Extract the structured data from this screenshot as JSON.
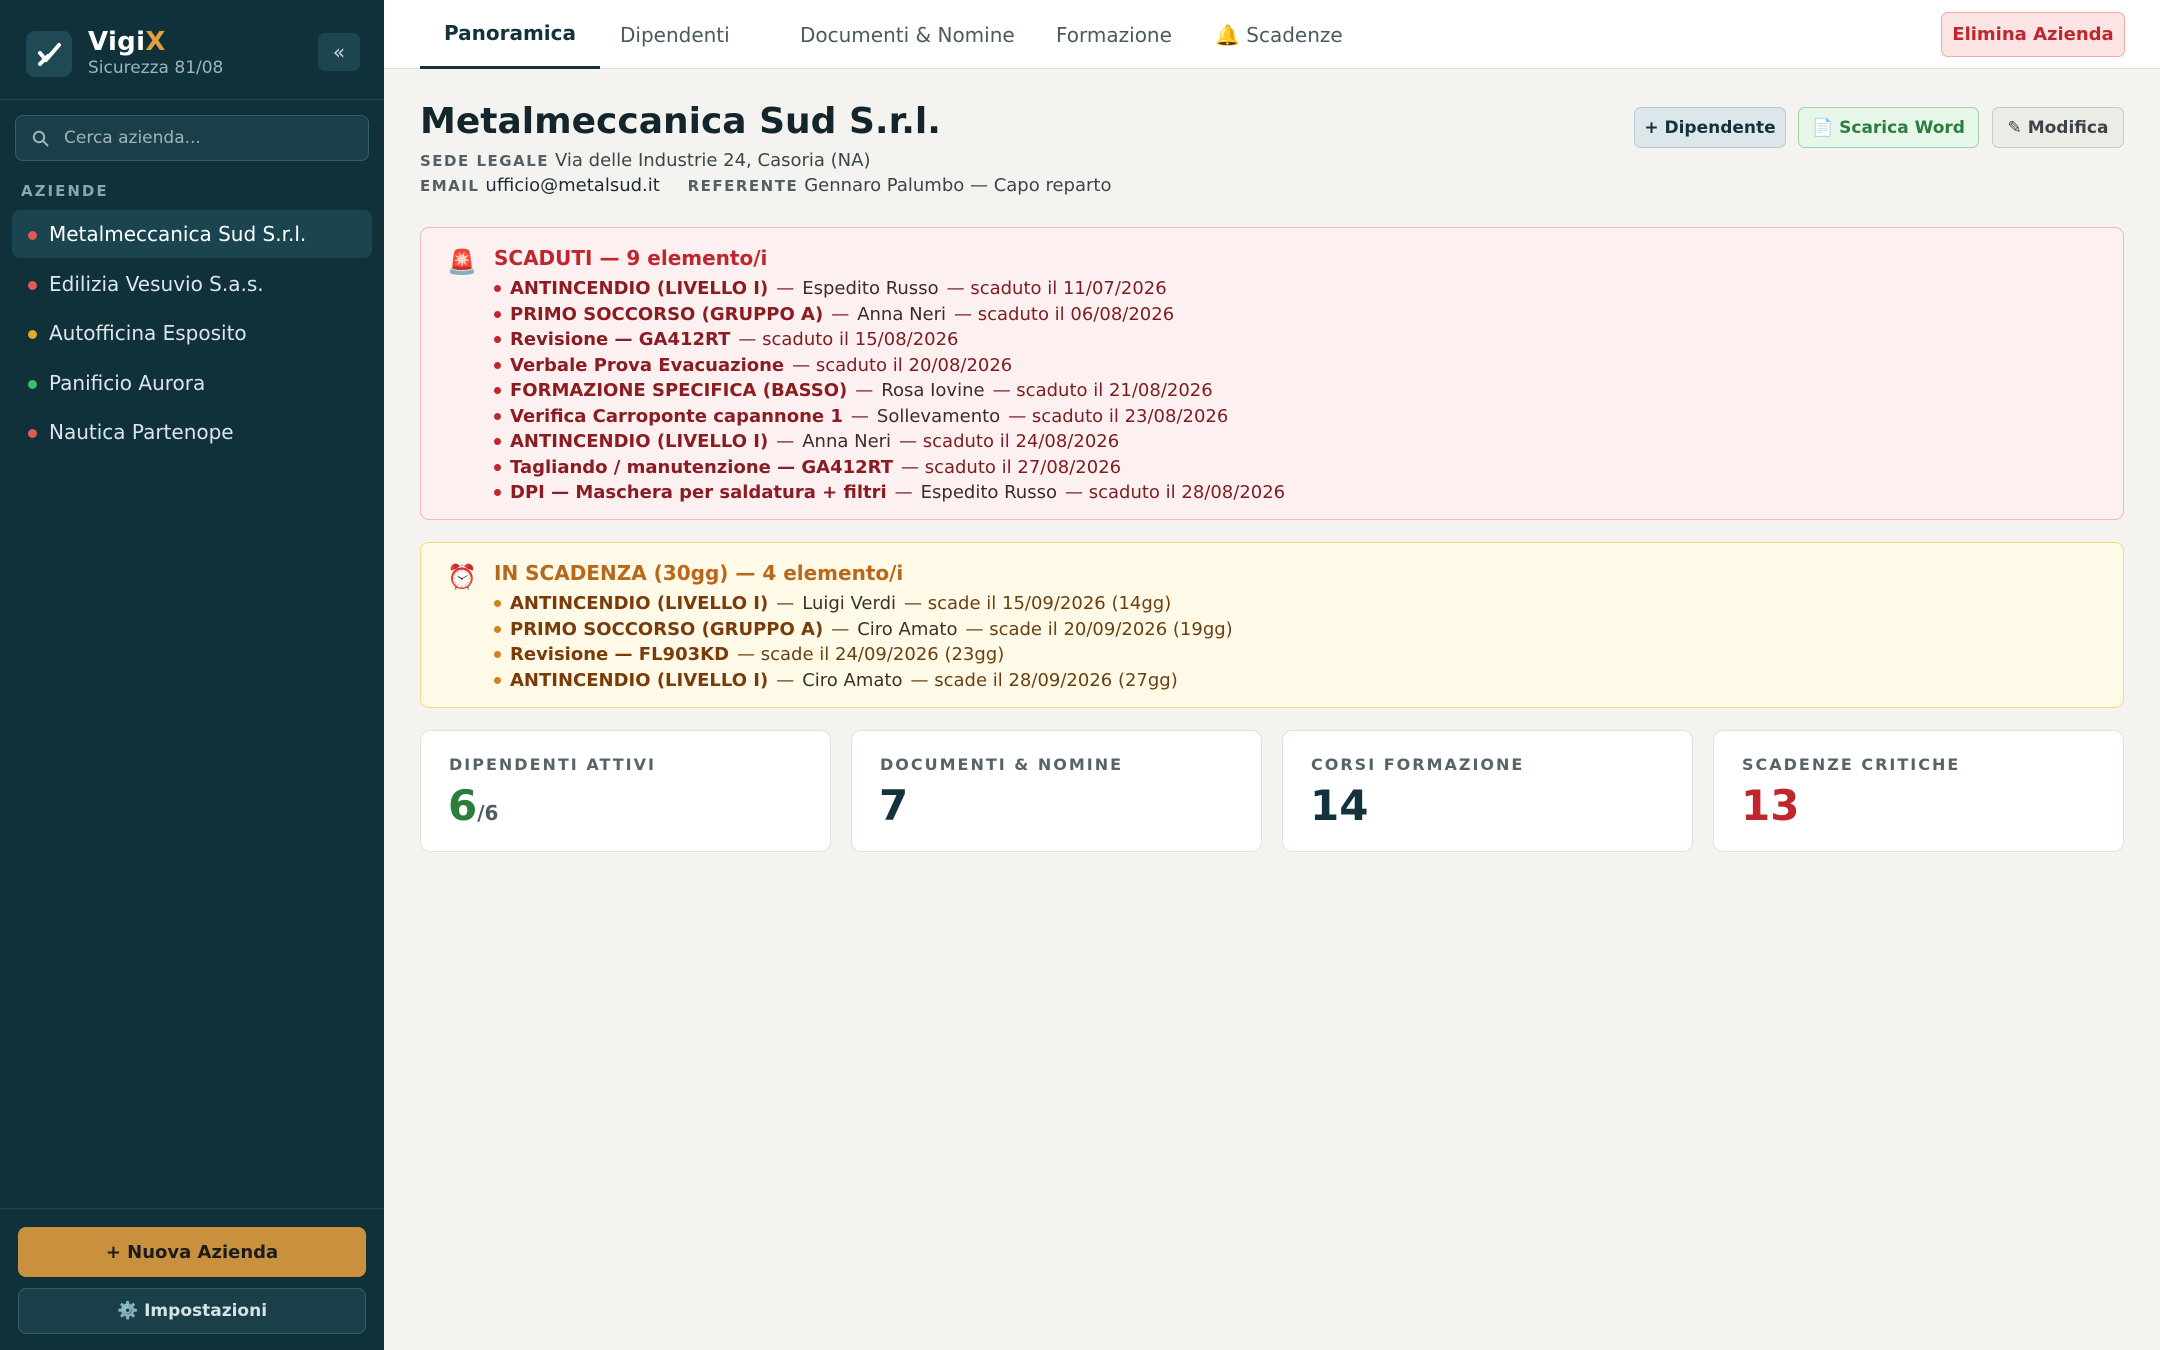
{
  "app": {
    "name_main": "Vigi",
    "name_accent": "X",
    "subtitle": "Sicurezza 81/08",
    "collapse_label": "«"
  },
  "sidebar": {
    "search_placeholder": "Cerca azienda...",
    "section_label": "AZIENDE",
    "companies": [
      {
        "name": "Metalmeccanica Sud S.r.l.",
        "status_color": "#e05a5a",
        "active": true
      },
      {
        "name": "Edilizia Vesuvio S.a.s.",
        "status_color": "#e05a5a",
        "active": false
      },
      {
        "name": "Autofficina Esposito",
        "status_color": "#e2a92a",
        "active": false
      },
      {
        "name": "Panificio Aurora",
        "status_color": "#3fbf6a",
        "active": false
      },
      {
        "name": "Nautica Partenope",
        "status_color": "#e05a5a",
        "active": false
      }
    ],
    "new_company_label": "+ Nuova Azienda",
    "settings_label": "Impostazioni",
    "settings_icon": "⚙️"
  },
  "tabs": [
    {
      "label": "Panoramica",
      "active": true
    },
    {
      "label": "Dipendenti",
      "active": false
    },
    {
      "label": "Documenti & Nomine",
      "active": false
    },
    {
      "label": "Formazione",
      "active": false
    },
    {
      "label": "🔔 Scadenze",
      "active": false
    }
  ],
  "delete_label": "Elimina Azienda",
  "company": {
    "name": "Metalmeccanica Sud S.r.l.",
    "sede_label": "SEDE LEGALE",
    "sede_value": "Via delle Industrie 24, Casoria (NA)",
    "email_label": "EMAIL",
    "email_value": "ufficio@metalsud.it",
    "referente_label": "REFERENTE",
    "referente_value": "Gennaro Palumbo — Capo reparto"
  },
  "actions": {
    "add_employee": "+ Dipendente",
    "download_word": "📄 Scarica Word",
    "edit": "✎ Modifica"
  },
  "expired": {
    "icon": "🚨",
    "title": "SCADUTI — 9 elemento/i",
    "items": [
      {
        "name": "ANTINCENDIO (LIVELLO I)",
        "person": "Espedito Russo",
        "date": "— scaduto il 11/07/2026"
      },
      {
        "name": "PRIMO SOCCORSO (GRUPPO A)",
        "person": "Anna Neri",
        "date": "— scaduto il 06/08/2026"
      },
      {
        "name": "Revisione — GA412RT",
        "person": "",
        "date": "— scaduto il 15/08/2026"
      },
      {
        "name": "Verbale Prova Evacuazione",
        "person": "",
        "date": "— scaduto il 20/08/2026"
      },
      {
        "name": "FORMAZIONE SPECIFICA (BASSO)",
        "person": "Rosa Iovine",
        "date": "— scaduto il 21/08/2026"
      },
      {
        "name": "Verifica Carroponte capannone 1",
        "person": "Sollevamento",
        "date": "— scaduto il 23/08/2026"
      },
      {
        "name": "ANTINCENDIO (LIVELLO I)",
        "person": "Anna Neri",
        "date": "— scaduto il 24/08/2026"
      },
      {
        "name": "Tagliando / manutenzione — GA412RT",
        "person": "",
        "date": "— scaduto il 27/08/2026"
      },
      {
        "name": "DPI — Maschera per saldatura + filtri",
        "person": "Espedito Russo",
        "date": "— scaduto il 28/08/2026"
      }
    ]
  },
  "expiring": {
    "icon": "⏰",
    "title": "IN SCADENZA (30gg) — 4 elemento/i",
    "items": [
      {
        "name": "ANTINCENDIO (LIVELLO I)",
        "person": "Luigi Verdi",
        "date": "— scade il 15/09/2026 (14gg)"
      },
      {
        "name": "PRIMO SOCCORSO (GRUPPO A)",
        "person": "Ciro Amato",
        "date": "— scade il 20/09/2026 (19gg)"
      },
      {
        "name": "Revisione — FL903KD",
        "person": "",
        "date": "— scade il 24/09/2026 (23gg)"
      },
      {
        "name": "ANTINCENDIO (LIVELLO I)",
        "person": "Ciro Amato",
        "date": "— scade il 28/09/2026 (27gg)"
      }
    ]
  },
  "stats": [
    {
      "label": "DIPENDENTI ATTIVI",
      "value": "6",
      "denominator": "/6",
      "color": "green"
    },
    {
      "label": "DOCUMENTI & NOMINE",
      "value": "7",
      "denominator": "",
      "color": "dark"
    },
    {
      "label": "CORSI FORMAZIONE",
      "value": "14",
      "denominator": "",
      "color": "dark"
    },
    {
      "label": "SCADENZE CRITICHE",
      "value": "13",
      "denominator": "",
      "color": "red"
    }
  ]
}
